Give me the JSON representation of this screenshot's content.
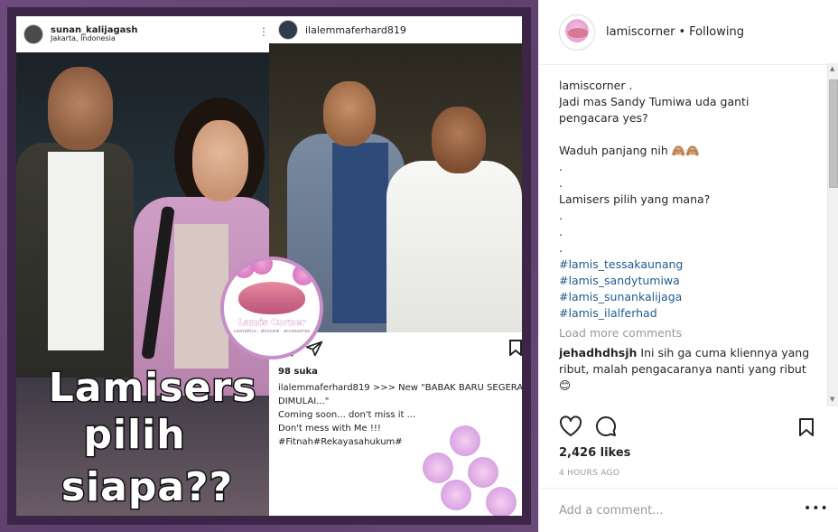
{
  "post_image": {
    "left_shot": {
      "username": "sunan_kalijagash",
      "location": "Jakarta, Indonesia",
      "menu_icon": "more-vertical-icon"
    },
    "overlay_text": {
      "line1": "Lamisers",
      "line2": "pilih",
      "line3": "siapa??"
    },
    "right_shot": {
      "username": "ilalemmaferhard819",
      "likes": "98 suka",
      "caption_line1": "ilalemmaferhard819 >>> New \"BABAK BARU SEGERA",
      "caption_line2": "DIMULAI...\"",
      "caption_line3": "Coming soon... don't miss it ...",
      "caption_line4": "Don't mess with Me !!!",
      "caption_line5": "#Fitnah#Rekayasahukum#"
    },
    "logo": {
      "name": "Lamis Corner",
      "tagline": "cosmetics · skincare · accessories"
    }
  },
  "panel": {
    "header": {
      "username": "lamiscorner",
      "separator": "•",
      "follow_status": "Following"
    },
    "caption": {
      "username_line": "lamiscorner .",
      "lines": [
        "Jadi mas Sandy Tumiwa uda ganti",
        "pengacara yes?",
        "",
        "Waduh panjang nih 🙈🙈",
        ".",
        ".",
        "Lamisers pilih yang mana?",
        ".",
        ".",
        "."
      ],
      "hashtags": [
        "#lamis_tessakaunang",
        "#lamis_sandytumiwa",
        "#lamis_sunankalijaga",
        "#lamis_ilalferhad"
      ]
    },
    "load_more": "Load more comments",
    "comment": {
      "username": "jehadhdhsjh",
      "text": " Ini sih ga cuma kliennya yang ribut, malah pengacaranya nanti yang ribut 😊"
    },
    "likes": "2,426 likes",
    "timestamp": "4 HOURS AGO",
    "add_comment_placeholder": "Add a comment...",
    "more_options": "•••",
    "icons": {
      "like": "heart-icon",
      "comment": "comment-bubble-icon",
      "bookmark": "bookmark-icon"
    }
  }
}
